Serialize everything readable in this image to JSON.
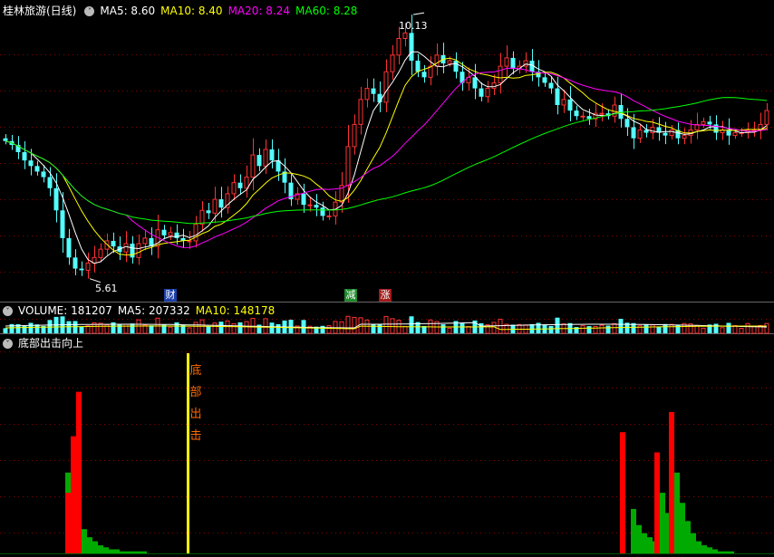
{
  "header": {
    "stock_name": "桂林旅游(日线)",
    "ma5": "MA5: 8.60",
    "ma10": "MA10: 8.40",
    "ma20": "MA20: 8.24",
    "ma60": "MA60: 8.28"
  },
  "volume_header": {
    "volume": "VOLUME: 181207",
    "ma5": "MA5: 207332",
    "ma10": "MA10: 148178"
  },
  "indicator_header": {
    "name": "底部出击向上"
  },
  "annotations": {
    "high_label": "10.13",
    "low_label": "5.61",
    "tag_cai": "财",
    "tag_jian": "减",
    "tag_zhang": "涨",
    "signal_text": [
      "底",
      "部",
      "出",
      "击"
    ]
  },
  "colors": {
    "up": "#ff3232",
    "down": "#54ffff",
    "ma5": "#ffffff",
    "ma10": "#ffff00",
    "ma20": "#ff00ff",
    "ma60": "#00ff00",
    "grid": "#8b0000",
    "signal": "#ffff00"
  },
  "chart_data": [
    {
      "type": "candlestick",
      "title": "桂林旅游(日线)",
      "ylim": [
        5.4,
        10.3
      ],
      "high_marker": 10.13,
      "low_marker": 5.61,
      "series": [
        {
          "name": "MA5",
          "color": "#ffffff"
        },
        {
          "name": "MA10",
          "color": "#ffff00"
        },
        {
          "name": "MA20",
          "color": "#ff00ff"
        },
        {
          "name": "MA60",
          "color": "#00ff00"
        }
      ],
      "close": [
        8.05,
        7.98,
        7.85,
        7.7,
        7.6,
        7.5,
        7.4,
        7.2,
        6.8,
        6.3,
        5.95,
        5.75,
        5.72,
        5.85,
        5.95,
        6.1,
        6.25,
        6.15,
        6.05,
        6.2,
        5.95,
        6.2,
        6.3,
        6.15,
        6.45,
        6.35,
        6.4,
        6.3,
        6.25,
        6.25,
        6.55,
        6.8,
        6.75,
        7.0,
        6.85,
        7.1,
        7.3,
        7.2,
        7.4,
        7.8,
        7.6,
        7.9,
        7.7,
        7.5,
        7.3,
        7.0,
        7.1,
        6.9,
        6.9,
        6.85,
        6.7,
        6.7,
        6.95,
        7.25,
        7.95,
        8.35,
        8.8,
        9.0,
        8.9,
        8.75,
        9.3,
        9.6,
        9.9,
        10.0,
        9.5,
        9.3,
        9.2,
        9.4,
        9.6,
        9.45,
        9.5,
        9.3,
        9.1,
        9.2,
        9.0,
        8.85,
        9.0,
        9.1,
        9.4,
        9.55,
        9.35,
        9.4,
        9.5,
        9.3,
        9.2,
        9.1,
        9.0,
        8.7,
        8.8,
        8.6,
        8.5,
        8.5,
        8.45,
        8.55,
        8.55,
        8.5,
        8.7,
        8.45,
        8.3,
        8.1,
        8.25,
        8.2,
        8.3,
        8.2,
        8.15,
        8.25,
        8.1,
        8.15,
        8.25,
        8.35,
        8.4,
        8.35,
        8.2,
        8.25,
        8.15,
        8.2,
        8.2,
        8.25,
        8.25,
        8.35,
        8.6
      ]
    },
    {
      "type": "bar",
      "title": "VOLUME",
      "values": [
        "181207",
        "207332",
        "148178"
      ]
    },
    {
      "type": "bar",
      "title": "底部出击向上",
      "ylim": [
        0,
        100
      ],
      "clusters": [
        {
          "start": 72,
          "red": [
            30,
            58,
            80
          ],
          "green": [
            40,
            26,
            18,
            12,
            8,
            6,
            4,
            3,
            2,
            2,
            1,
            1,
            1,
            1,
            1
          ]
        },
        {
          "start": 684,
          "red": [
            60,
            0,
            0,
            0,
            0,
            0,
            0,
            0,
            0,
            0,
            0,
            0,
            0
          ],
          "green": [
            0,
            0,
            22,
            14,
            10,
            8,
            6,
            4,
            2,
            2,
            1,
            1,
            1
          ]
        },
        {
          "start": 722,
          "red": [
            50,
            0,
            0,
            0,
            0,
            0
          ],
          "green": [
            0,
            30,
            20,
            0,
            0,
            0
          ]
        },
        {
          "start": 738,
          "red": [
            70,
            0,
            0,
            0,
            0
          ],
          "green": [
            0,
            40,
            25,
            16,
            10,
            6,
            4,
            3,
            2,
            1,
            1,
            1
          ]
        }
      ],
      "signal_x": 207
    }
  ]
}
